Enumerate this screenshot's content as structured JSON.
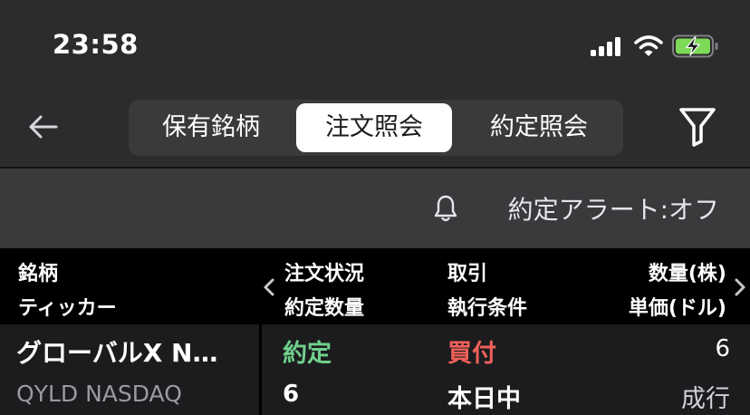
{
  "status_bar": {
    "time": "23:58"
  },
  "nav": {
    "tabs": [
      {
        "label": "保有銘柄",
        "active": false
      },
      {
        "label": "注文照会",
        "active": true
      },
      {
        "label": "約定照会",
        "active": false
      }
    ]
  },
  "alert": {
    "label": "約定アラート:オフ"
  },
  "table": {
    "headers": {
      "name": "銘柄",
      "ticker": "ティッカー",
      "order_status": "注文状況",
      "filled_qty": "約定数量",
      "trade": "取引",
      "exec_condition": "執行条件",
      "quantity": "数量(株)",
      "unit_price": "単価(ドル)"
    },
    "rows": [
      {
        "name": "グローバルX N…",
        "ticker": "QYLD NASDAQ",
        "status": "約定",
        "filled_qty": "6",
        "side": "買付",
        "condition": "本日中",
        "quantity": "6",
        "price": "成行"
      }
    ]
  },
  "colors": {
    "status_filled": "#6fd08c",
    "side_buy": "#f0605a",
    "accent_white": "#ffffff",
    "battery_fill": "#7ed957"
  }
}
